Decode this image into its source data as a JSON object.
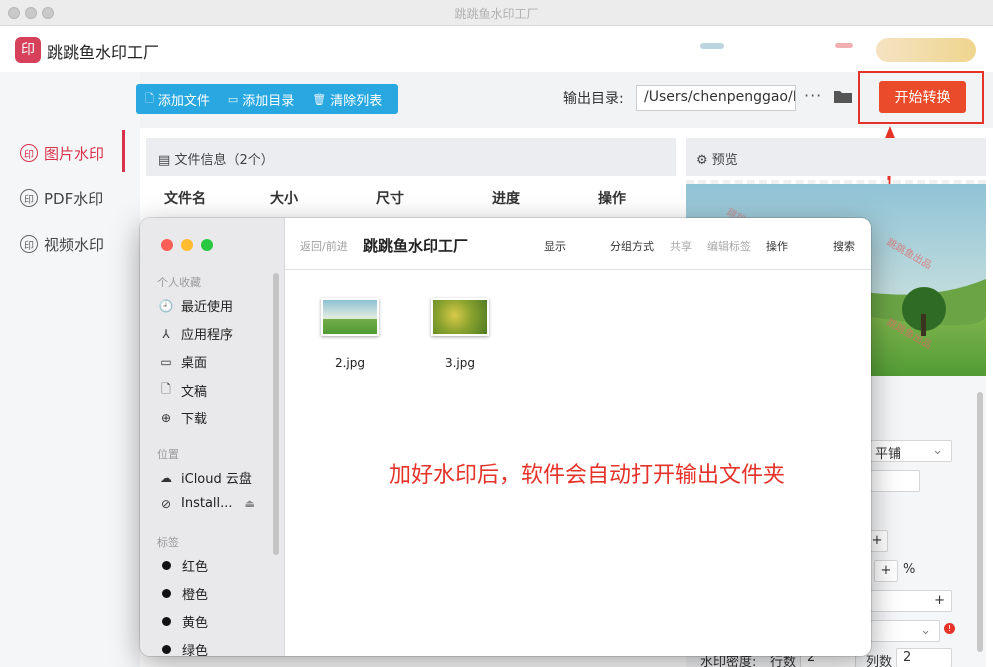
{
  "window": {
    "title": "跳跳鱼水印工厂"
  },
  "app": {
    "logo_text": "印",
    "name": "跳跳鱼水印工厂"
  },
  "sidebar": {
    "items": [
      {
        "label": "图片水印",
        "icon": "印",
        "active": true
      },
      {
        "label": "PDF水印",
        "icon": "印",
        "active": false
      },
      {
        "label": "视频水印",
        "icon": "印",
        "active": false
      }
    ]
  },
  "toolbar": {
    "add_file": "添加文件",
    "add_dir": "添加目录",
    "clear_list": "清除列表",
    "output_label": "输出目录:",
    "output_path": "/Users/chenpenggao/D",
    "more": "···",
    "start": "开始转换"
  },
  "filelist": {
    "header": "文件信息（2个）",
    "columns": [
      "文件名",
      "大小",
      "尺寸",
      "进度",
      "操作"
    ]
  },
  "preview": {
    "title": "预览",
    "watermark_text": "跳跳鱼出品"
  },
  "settings": {
    "layout_value": "平铺",
    "percent": "%",
    "density_label": "水印密度:",
    "rows_label": "行数",
    "rows_value": "2",
    "cols_label": "列数",
    "cols_value": "2"
  },
  "finder": {
    "nav": "返回/前进",
    "title": "跳跳鱼水印工厂",
    "menu": {
      "display": "显示",
      "group": "分组方式",
      "share": "共享",
      "tags": "编辑标签",
      "action": "操作",
      "search": "搜索"
    },
    "sections": {
      "favorites": "个人收藏",
      "locations": "位置",
      "tags": "标签"
    },
    "favorites": [
      "最近使用",
      "应用程序",
      "桌面",
      "文稿",
      "下载"
    ],
    "locations": [
      "iCloud 云盘",
      "Install..."
    ],
    "tags": [
      "红色",
      "橙色",
      "黄色",
      "绿色"
    ],
    "files": [
      "2.jpg",
      "3.jpg"
    ]
  },
  "annotation": {
    "text": "加好水印后，软件会自动打开输出文件夹"
  },
  "colors": {
    "accent": "#d8334a",
    "primary_blue": "#29a7e1",
    "start_button": "#ea4b2b",
    "annotation_red": "#e5332a"
  }
}
